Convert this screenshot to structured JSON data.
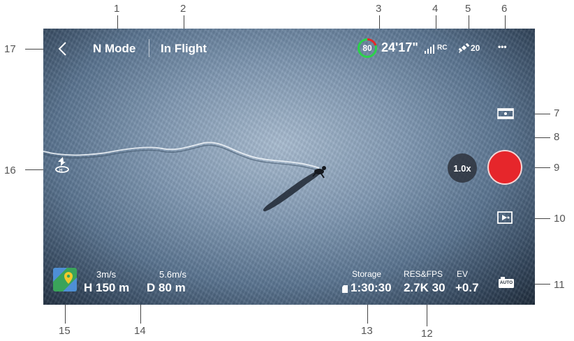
{
  "callouts": [
    "1",
    "2",
    "3",
    "4",
    "5",
    "6",
    "7",
    "8",
    "9",
    "10",
    "11",
    "12",
    "13",
    "14",
    "15",
    "16",
    "17"
  ],
  "hud": {
    "mode": "N Mode",
    "status": "In Flight",
    "battery_percent": "80",
    "battery_fraction": 0.8,
    "flight_time": "24'17\"",
    "rc_label": "RC",
    "gps_count": "20",
    "more": "•••",
    "zoom": "1.0x",
    "vertical_speed": "3m/s",
    "height": "H 150 m",
    "horizontal_speed": "5.6m/s",
    "distance": "D 80 m",
    "storage_label": "Storage",
    "storage_value": "1:30:30",
    "resfps_label": "RES&FPS",
    "resfps_value": "2.7K 30",
    "ev_label": "EV",
    "ev_value": "+0.7",
    "auto_label": "AUTO"
  },
  "colors": {
    "record": "#e6262b",
    "battery_ring": "#2bd24a",
    "battery_alert": "#e6262b"
  }
}
